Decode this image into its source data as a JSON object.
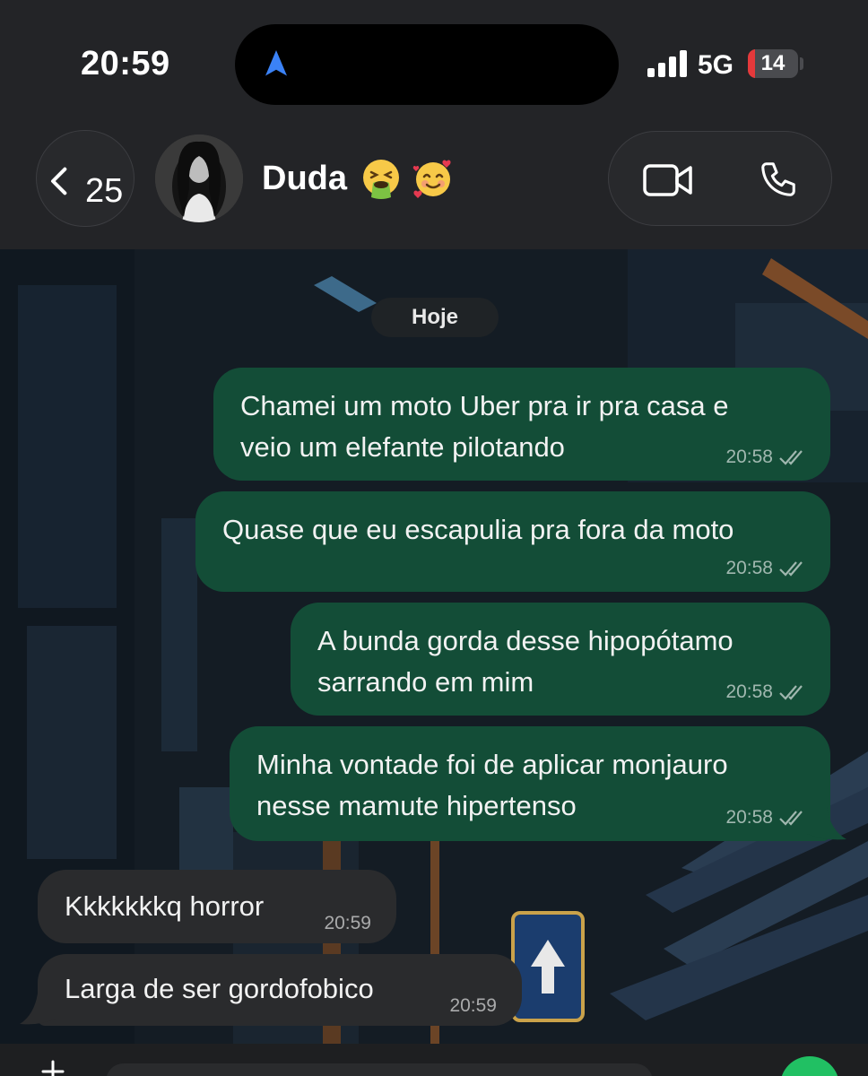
{
  "status_bar": {
    "time": "20:59",
    "network": "5G",
    "battery_level": "14",
    "battery_fraction": 0.14,
    "icons": [
      "navigation-arrow-icon",
      "signal-bars-icon",
      "battery-icon"
    ]
  },
  "header": {
    "back_count": "25",
    "contact_name": "Duda",
    "emojis": [
      "nauseated-face-icon",
      "smiling-face-with-hearts-icon"
    ],
    "actions": [
      "video-call-icon",
      "voice-call-icon"
    ]
  },
  "chat": {
    "date_label": "Hoje",
    "messages": [
      {
        "direction": "outgoing",
        "text": "Chamei um moto Uber pra ir pra casa e\nveio um elefante pilotando",
        "time": "20:58",
        "status": "read"
      },
      {
        "direction": "outgoing",
        "text": "Quase que eu escapulia pra fora da moto",
        "time": "20:58",
        "status": "read"
      },
      {
        "direction": "outgoing",
        "text": "A bunda gorda desse hipopótamo\nsarrando em mim",
        "time": "20:58",
        "status": "read"
      },
      {
        "direction": "outgoing",
        "text": "Minha vontade foi de aplicar monjauro\nnesse mamute hipertenso",
        "time": "20:58",
        "status": "read"
      },
      {
        "direction": "incoming",
        "text": "Kkkkkkkq horror",
        "time": "20:59"
      },
      {
        "direction": "incoming",
        "text": "Larga de ser gordofobico",
        "time": "20:59"
      }
    ]
  },
  "colors": {
    "outgoing_bubble": "#134d37",
    "incoming_bubble": "#2a2b2d",
    "accent_blue": "#3b82f6",
    "battery_red": "#e5393b"
  }
}
